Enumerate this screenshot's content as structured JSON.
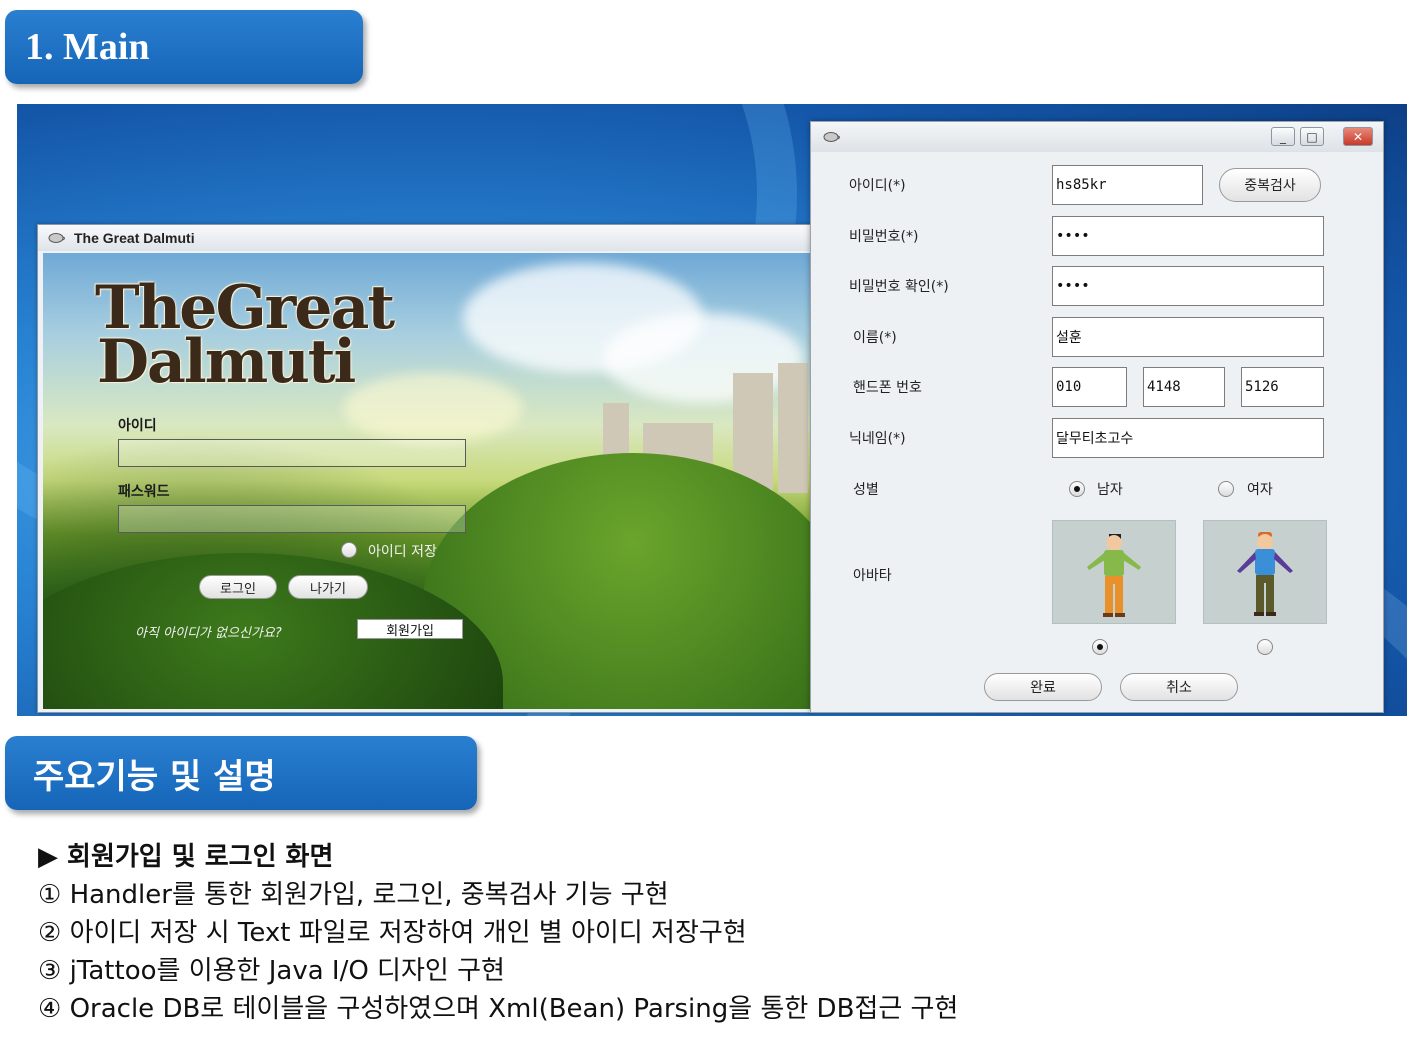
{
  "sections": {
    "main_title": "1. Main",
    "features_title": "주요기능 및 설명"
  },
  "login_window": {
    "title": "The Great Dalmuti",
    "logo_line1": "TheGreat",
    "logo_line2": "Dalmuti",
    "id_label": "아이디",
    "password_label": "패스워드",
    "save_id_label": "아이디 저장",
    "login_button": "로그인",
    "exit_button": "나가기",
    "no_account_text": "아직 아이디가 없으신가요?",
    "signup_button": "회원가입"
  },
  "register_window": {
    "fields": {
      "id": {
        "label": "아이디(*)",
        "value": "hs85kr"
      },
      "password": {
        "label": "비밀번호(*)",
        "value": "••••"
      },
      "password_confirm": {
        "label": "비밀번호 확인(*)",
        "value": "••••"
      },
      "name": {
        "label": "이름(*)",
        "value": "설훈"
      },
      "phone": {
        "label": "핸드폰 번호",
        "part1": "010",
        "part2": "4148",
        "part3": "5126"
      },
      "nickname": {
        "label": "닉네임(*)",
        "value": "달무티초고수"
      }
    },
    "duplicate_check_button": "중복검사",
    "gender_label": "성별",
    "gender_male": "남자",
    "gender_female": "여자",
    "selected_gender": "male",
    "avatar_label": "아바타",
    "selected_avatar": 1,
    "complete_button": "완료",
    "cancel_button": "취소",
    "window_controls": {
      "minimize": "_",
      "maximize": "□",
      "close": "✕"
    }
  },
  "description": {
    "heading": "▶ 회원가입 및 로그인 화면",
    "items": [
      "① Handler를 통한 회원가입, 로그인, 중복검사 기능 구현",
      "② 아이디 저장 시  Text 파일로 저장하여 개인 별 아이디 저장구현",
      "③ jTattoo를 이용한 Java I/O 디자인 구현",
      "④ Oracle DB로 테이블을 구성하였으며 Xml(Bean) Parsing을 통한 DB접근 구현"
    ]
  },
  "colors": {
    "tab_blue": "#1565b8",
    "desktop_blue": "#2a86d6",
    "close_red": "#c7392a"
  }
}
